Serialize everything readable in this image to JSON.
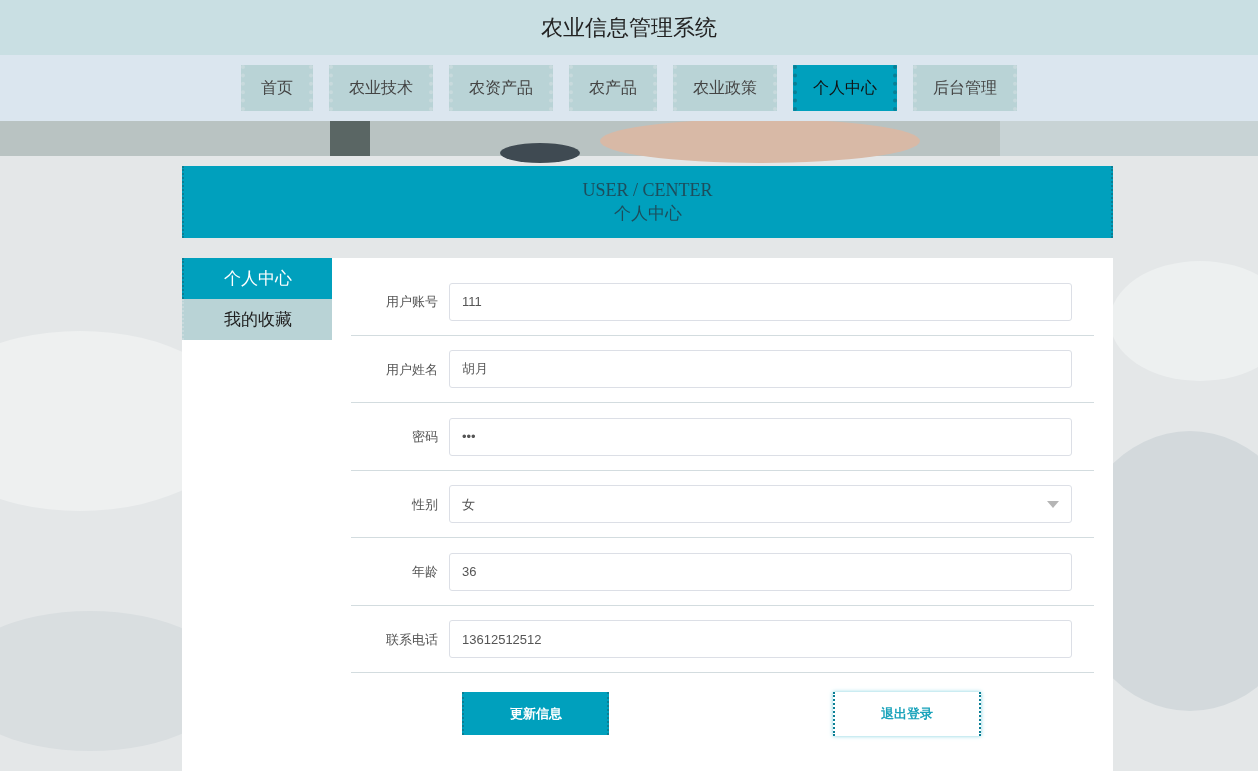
{
  "header": {
    "title": "农业信息管理系统"
  },
  "nav": [
    {
      "label": "首页",
      "selected": false
    },
    {
      "label": "农业技术",
      "selected": false
    },
    {
      "label": "农资产品",
      "selected": false
    },
    {
      "label": "农产品",
      "selected": false
    },
    {
      "label": "农业政策",
      "selected": false
    },
    {
      "label": "个人中心",
      "selected": true
    },
    {
      "label": "后台管理",
      "selected": false
    }
  ],
  "section_title": {
    "english": "USER / CENTER",
    "chinese": "个人中心"
  },
  "sidebar": {
    "items": [
      {
        "label": "个人中心",
        "selected": true
      },
      {
        "label": "我的收藏",
        "selected": false
      }
    ]
  },
  "form": {
    "fields": [
      {
        "kind": "text",
        "label": "用户账号",
        "value": "111"
      },
      {
        "kind": "text",
        "label": "用户姓名",
        "value": "胡月"
      },
      {
        "kind": "text",
        "label": "密码",
        "value": "•••"
      },
      {
        "kind": "select",
        "label": "性别",
        "value": "女"
      },
      {
        "kind": "text",
        "label": "年龄",
        "value": "36"
      },
      {
        "kind": "text",
        "label": "联系电话",
        "value": "13612512512"
      }
    ],
    "buttons": [
      {
        "kind": "primary",
        "label": "更新信息"
      },
      {
        "kind": "outline",
        "label": "退出登录"
      }
    ]
  }
}
